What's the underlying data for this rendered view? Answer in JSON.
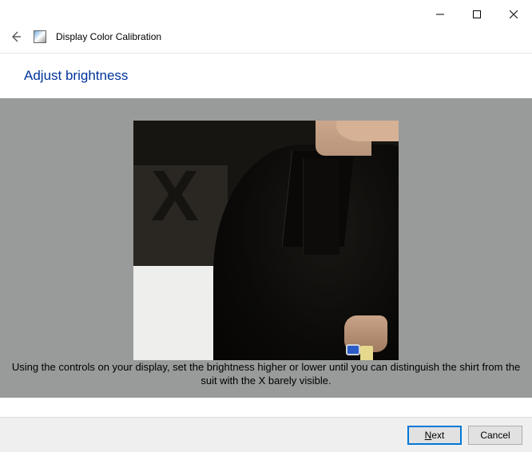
{
  "window": {
    "title": "Display Color Calibration"
  },
  "page": {
    "heading": "Adjust brightness",
    "instruction": "Using the controls on your display, set the brightness higher or lower until you can distinguish the shirt from the suit with the X barely visible."
  },
  "sample": {
    "x_char": "X"
  },
  "buttons": {
    "next_prefix": "N",
    "next_rest": "ext",
    "cancel": "Cancel"
  }
}
